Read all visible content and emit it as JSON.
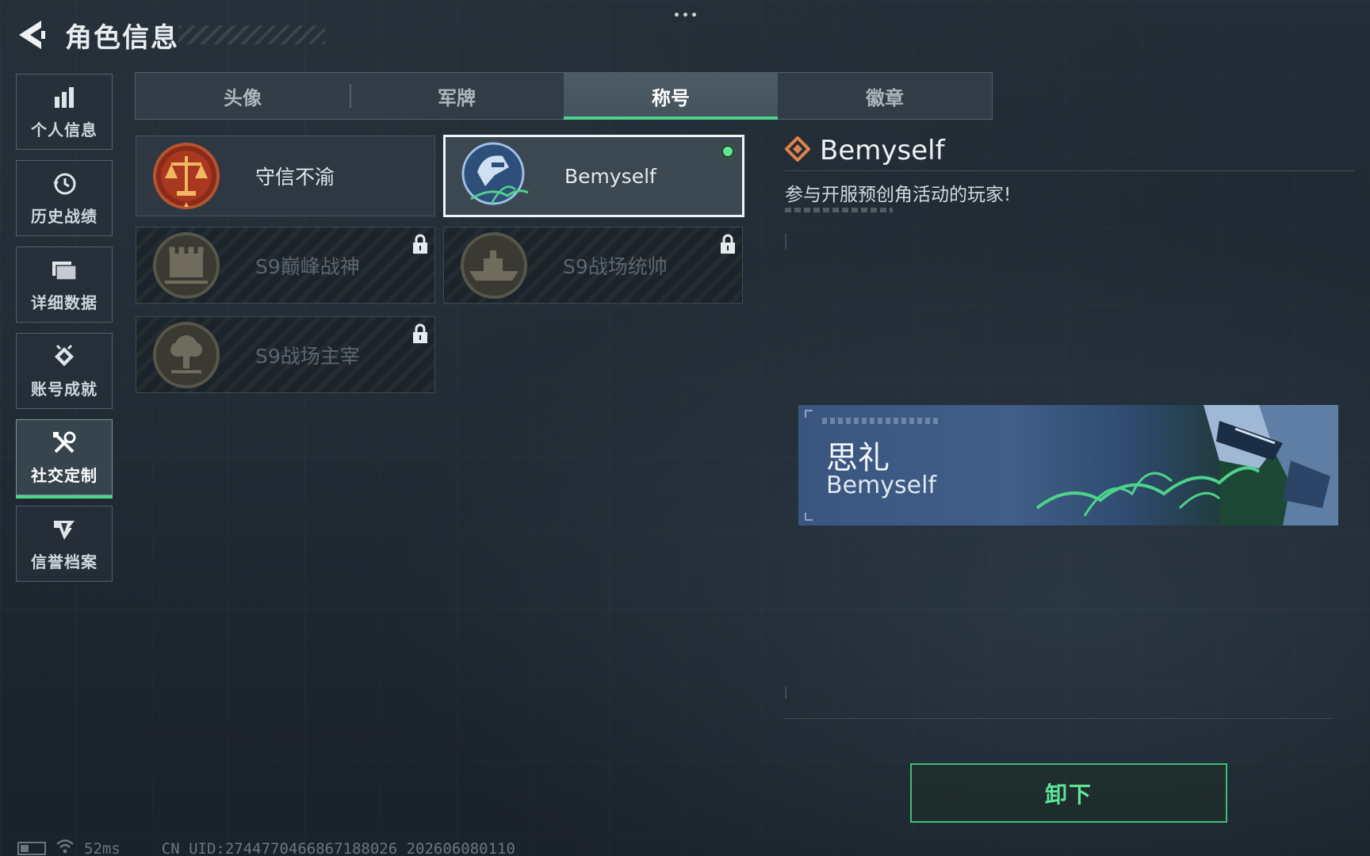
{
  "header": {
    "title": "角色信息"
  },
  "sidebar": {
    "items": [
      {
        "label": "个人信息",
        "icon": "bar-chart-icon",
        "active": false
      },
      {
        "label": "历史战绩",
        "icon": "history-clock-icon",
        "active": false
      },
      {
        "label": "详细数据",
        "icon": "folder-icon",
        "active": false
      },
      {
        "label": "账号成就",
        "icon": "achievement-icon",
        "active": false
      },
      {
        "label": "社交定制",
        "icon": "tools-icon",
        "active": true
      },
      {
        "label": "信誉档案",
        "icon": "reputation-icon",
        "active": false
      }
    ]
  },
  "tabs": [
    {
      "label": "头像",
      "active": false
    },
    {
      "label": "军牌",
      "active": false
    },
    {
      "label": "称号",
      "active": true
    },
    {
      "label": "徽章",
      "active": false
    }
  ],
  "titles": [
    {
      "name": "守信不渝",
      "locked": false,
      "selected": false,
      "emblem": "scales-emblem-icon"
    },
    {
      "name": "Bemyself",
      "locked": false,
      "selected": true,
      "equipped": true,
      "emblem": "bemyself-emblem-icon"
    },
    {
      "name": "S9巅峰战神",
      "locked": true,
      "selected": false,
      "emblem": "fortress-emblem-icon"
    },
    {
      "name": "S9战场统帅",
      "locked": true,
      "selected": false,
      "emblem": "warship-emblem-icon"
    },
    {
      "name": "S9战场主宰",
      "locked": true,
      "selected": false,
      "emblem": "explosion-emblem-icon"
    }
  ],
  "detail": {
    "name": "Bemyself",
    "description": "参与开服预创角活动的玩家!"
  },
  "preview": {
    "player_name": "思礼",
    "title": "Bemyself"
  },
  "actions": {
    "unequip_label": "卸下"
  },
  "status": {
    "ping": "52ms",
    "uid": "CN UID:2744770466867188026 202606080110"
  },
  "colors": {
    "accent_green": "#4ed38a",
    "background": "#1f2831",
    "detail_icon_orange": "#e0824a"
  }
}
